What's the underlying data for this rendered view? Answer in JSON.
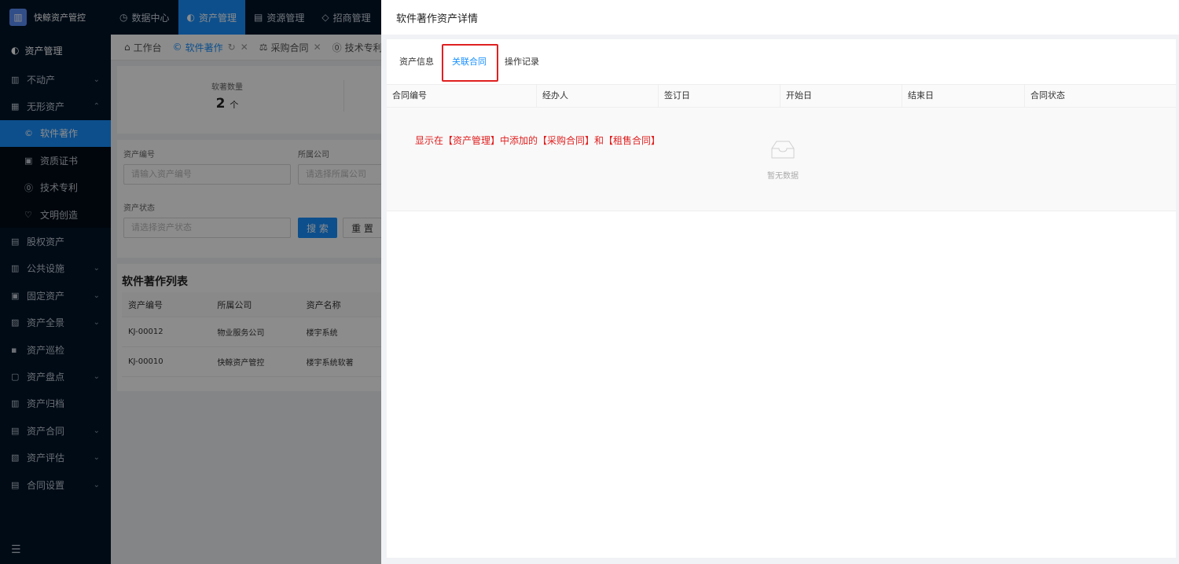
{
  "app": {
    "brand": "快鲸资产管控",
    "logo_icon": "building-icon"
  },
  "topnav": [
    {
      "label": "数据中心",
      "icon": "clock-icon"
    },
    {
      "label": "资产管理",
      "icon": "cube-icon",
      "active": true
    },
    {
      "label": "资源管理",
      "icon": "doc-icon"
    },
    {
      "label": "招商管理",
      "icon": "tag-icon"
    }
  ],
  "sidebar": {
    "header": "资产管理",
    "items": [
      {
        "label": "不动产",
        "icon": "building-icon",
        "arrow": "⌄"
      },
      {
        "label": "无形资产",
        "icon": "grid-icon",
        "arrow": "⌃"
      }
    ],
    "sub_items": [
      {
        "label": "软件著作",
        "icon": "copyright-icon",
        "active": true
      },
      {
        "label": "资质证书",
        "icon": "certificate-icon"
      },
      {
        "label": "技术专利",
        "icon": "patent-icon"
      },
      {
        "label": "文明创造",
        "icon": "bulb-icon"
      }
    ],
    "items_after": [
      {
        "label": "股权资产",
        "icon": "equity-icon",
        "arrow": ""
      },
      {
        "label": "公共设施",
        "icon": "facility-icon",
        "arrow": "⌄"
      },
      {
        "label": "固定资产",
        "icon": "fixed-icon",
        "arrow": "⌄"
      },
      {
        "label": "资产全景",
        "icon": "panorama-icon",
        "arrow": "⌄"
      },
      {
        "label": "资产巡检",
        "icon": "inspect-icon",
        "arrow": ""
      },
      {
        "label": "资产盘点",
        "icon": "inventory-icon",
        "arrow": "⌄"
      },
      {
        "label": "资产归档",
        "icon": "archive-icon",
        "arrow": ""
      },
      {
        "label": "资产合同",
        "icon": "contract-icon",
        "arrow": "⌄"
      },
      {
        "label": "资产评估",
        "icon": "evaluate-icon",
        "arrow": "⌄"
      },
      {
        "label": "合同设置",
        "icon": "settings-icon",
        "arrow": "⌄"
      }
    ],
    "collapse_icon": "☰"
  },
  "tabs": [
    {
      "label": "工作台",
      "icon": "⌂"
    },
    {
      "label": "软件著作",
      "icon": "©",
      "active": true,
      "refresh": "↻",
      "close": "✕"
    },
    {
      "label": "采购合同",
      "icon": "⚖",
      "close": "✕"
    },
    {
      "label": "技术专利",
      "icon": "⓪"
    }
  ],
  "stats": {
    "label": "软著数量",
    "value": "2",
    "unit": "个"
  },
  "filters": {
    "asset_no_label": "资产编号",
    "asset_no_placeholder": "请输入资产编号",
    "company_label": "所属公司",
    "company_placeholder": "请选择所属公司",
    "status_label": "资产状态",
    "status_placeholder": "请选择资产状态",
    "search_btn": "搜 索",
    "reset_btn": "重 置"
  },
  "list": {
    "title": "软件著作列表",
    "columns": [
      "资产编号",
      "所属公司",
      "资产名称"
    ],
    "rows": [
      [
        "KJ-00012",
        "物业服务公司",
        "楼宇系统"
      ],
      [
        "KJ-00010",
        "快鲸资产管控",
        "楼宇系统软著"
      ]
    ]
  },
  "drawer": {
    "title": "软件著作资产详情",
    "tabs": [
      "资产信息",
      "关联合同",
      "操作记录"
    ],
    "active_tab": 1,
    "columns": [
      "合同编号",
      "经办人",
      "签订日",
      "开始日",
      "结束日",
      "合同状态"
    ],
    "annotation": "显示在【资产管理】中添加的【采购合同】和【租售合同】",
    "empty_text": "暂无数据",
    "highlight_color": "#e02020"
  }
}
